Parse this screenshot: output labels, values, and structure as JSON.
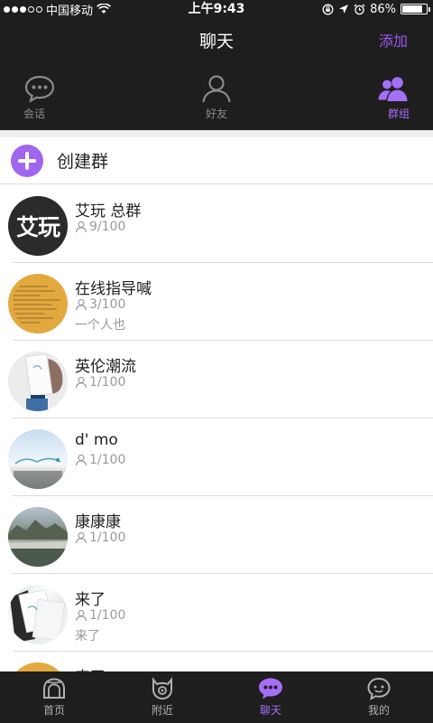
{
  "status_bar": {
    "carrier": "中国移动",
    "time": "上午9:43",
    "battery": "86%",
    "battery_level": 0.86,
    "icons": [
      "signal-dots-icon",
      "wifi-icon",
      "rotation-lock-icon",
      "location-arrow-icon",
      "alarm-icon",
      "battery-icon"
    ]
  },
  "nav": {
    "title": "聊天",
    "action": "添加"
  },
  "top_tabs": [
    {
      "label": "会话",
      "icon": "chat-bubble-icon",
      "active": false
    },
    {
      "label": "好友",
      "icon": "person-icon",
      "active": false
    },
    {
      "label": "群组",
      "icon": "group-icon",
      "active": true
    }
  ],
  "create_group": {
    "label": "创建群",
    "icon": "plus-circle-icon"
  },
  "groups": [
    {
      "name": "艾玩 总群",
      "count": "9/100",
      "last_message": "",
      "avatar_text": "艾玩"
    },
    {
      "name": "在线指导喊",
      "count": "3/100",
      "last_message": "一个人也"
    },
    {
      "name": "英伦潮流",
      "count": "1/100",
      "last_message": ""
    },
    {
      "name": "d' mo",
      "count": "1/100",
      "last_message": ""
    },
    {
      "name": "康康康",
      "count": "1/100",
      "last_message": ""
    },
    {
      "name": "来了",
      "count": "1/100",
      "last_message": "来了"
    },
    {
      "name": "来了",
      "count": "",
      "last_message": ""
    }
  ],
  "bottom_tabs": [
    {
      "label": "首页",
      "icon": "home-icon",
      "active": false
    },
    {
      "label": "附近",
      "icon": "nearby-icon",
      "active": false
    },
    {
      "label": "聊天",
      "icon": "chat-icon",
      "active": true
    },
    {
      "label": "我的",
      "icon": "profile-icon",
      "active": false
    }
  ],
  "colors": {
    "accent": "#a56ef7",
    "bar_background": "#1e1e1e",
    "inactive": "#8a8a8a"
  }
}
